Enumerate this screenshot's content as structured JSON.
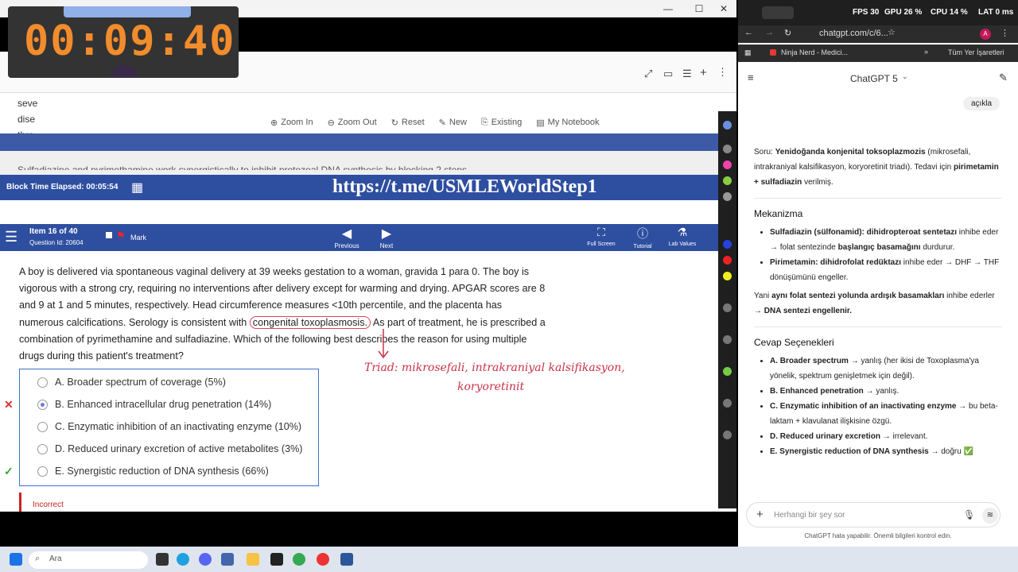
{
  "timer": "00:09:40",
  "calc_toolbar": {
    "zoom_in": "Zoom In",
    "zoom_out": "Zoom Out",
    "reset": "Reset",
    "new": "New",
    "existing": "Existing",
    "notebook": "My Notebook"
  },
  "background_text": "Sulfadiazine and pyrimethamine work synergistically to inhibit protozoal DNA synthesis by blocking 2 steps",
  "block_time": "Block Time Elapsed: 00:05:54",
  "overlay_url": "https://t.me/USMLEWorldStep1",
  "nav": {
    "item": "Item 16 of 40",
    "question_id": "Question Id: 20604",
    "mark": "Mark",
    "previous": "Previous",
    "next": "Next",
    "full_screen": "Full Screen",
    "tutorial": "Tutorial",
    "lab_values": "Lab Values"
  },
  "question": {
    "part1": "A boy is delivered via spontaneous vaginal delivery at 39 weeks gestation to a woman, gravida 1 para 0.  The boy is vigorous with a strong cry, requiring no interventions after delivery except for warming and drying.  APGAR scores are 8 and 9 at 1 and 5 minutes, respectively.  Head circumference measures <10th percentile, and the placenta has numerous calcifications.  Serology is consistent with ",
    "highlight": "congenital toxoplasmosis.",
    "part2": "  As part of treatment, he is prescribed a combination of pyrimethamine and sulfadiazine.  Which of the following best describes the reason for using multiple drugs during this patient's treatment?"
  },
  "answers": [
    {
      "text": "A.  Broader spectrum of coverage (5%)",
      "mark": ""
    },
    {
      "text": "B.  Enhanced intracellular drug penetration (14%)",
      "mark": "✕"
    },
    {
      "text": "C.  Enzymatic inhibition of an inactivating enzyme (10%)",
      "mark": ""
    },
    {
      "text": "D.  Reduced urinary excretion of active metabolites (3%)",
      "mark": ""
    },
    {
      "text": "E.  Synergistic reduction of DNA synthesis (66%)",
      "mark": "✓"
    }
  ],
  "result": "Incorrect",
  "handwriting": {
    "line1": "Triad: mikrosefali, intrakraniyal kalsifikasyon,",
    "line2": "koryoretinit"
  },
  "browser": {
    "stats": {
      "fps": "FPS 30",
      "gpu": "GPU 26 %",
      "cpu": "CPU 14 %",
      "lat": "LAT 0 ms"
    },
    "address": "chatgpt.com/c/6...",
    "bookmark1": "Ninja Nerd - Medici...",
    "bookmark_all": "Tüm Yer İşaretleri",
    "model": "ChatGPT 5"
  },
  "chat": {
    "user_msg": "açıkla",
    "intro_lead": "Soru: ",
    "intro_bold": "Yenidoğanda konjenital toksoplazmozis",
    "intro_rest": " (mikrosefali, intrakraniyal kalsifikasyon, koryoretinit triadı). Tedavi için ",
    "intro_bold2": "pirimetamin + sulfadiazin",
    "intro_end": " verilmiş.",
    "mech_title": "Mekanizma",
    "mech1_bold": "Sulfadiazin (sülfonamid): dihidropteroat sentetazı",
    "mech1_rest": " inhibe eder → folat sentezinde ",
    "mech1_bold2": "başlangıç basamağını",
    "mech1_end": " durdurur.",
    "mech2_bold": "Pirimetamin: dihidrofolat redüktazı",
    "mech2_rest": " inhibe eder → DHF → THF dönüşümünü engeller.",
    "sum_lead": "Yani ",
    "sum_bold": "aynı folat sentezi yolunda ardışık basamakları",
    "sum_rest": " inhibe ederler → ",
    "sum_bold2": "DNA sentezi engellenir.",
    "opts_title": "Cevap Seçenekleri",
    "opt1_bold": "A. Broader spectrum",
    "opt1_rest": " → yanlış (her ikisi de Toxoplasma'ya yönelik, spektrum genişletmek için değil).",
    "opt2_bold": "B. Enhanced penetration",
    "opt2_rest": " → yanlış.",
    "opt3_bold": "C. Enzymatic inhibition of an inactivating enzyme",
    "opt3_rest": " → bu beta-laktam + klavulanat ilişkisine özgü.",
    "opt4_bold": "D. Reduced urinary excretion",
    "opt4_rest": " → irrelevant.",
    "opt5_bold": "E. Synergistic reduction of DNA synthesis",
    "opt5_rest": " → doğru ✅",
    "input_placeholder": "Herhangi bir şey sor",
    "footnote": "ChatGPT hata yapabilir. Önemli bilgileri kontrol edin."
  },
  "taskbar": {
    "search": "Ara"
  }
}
